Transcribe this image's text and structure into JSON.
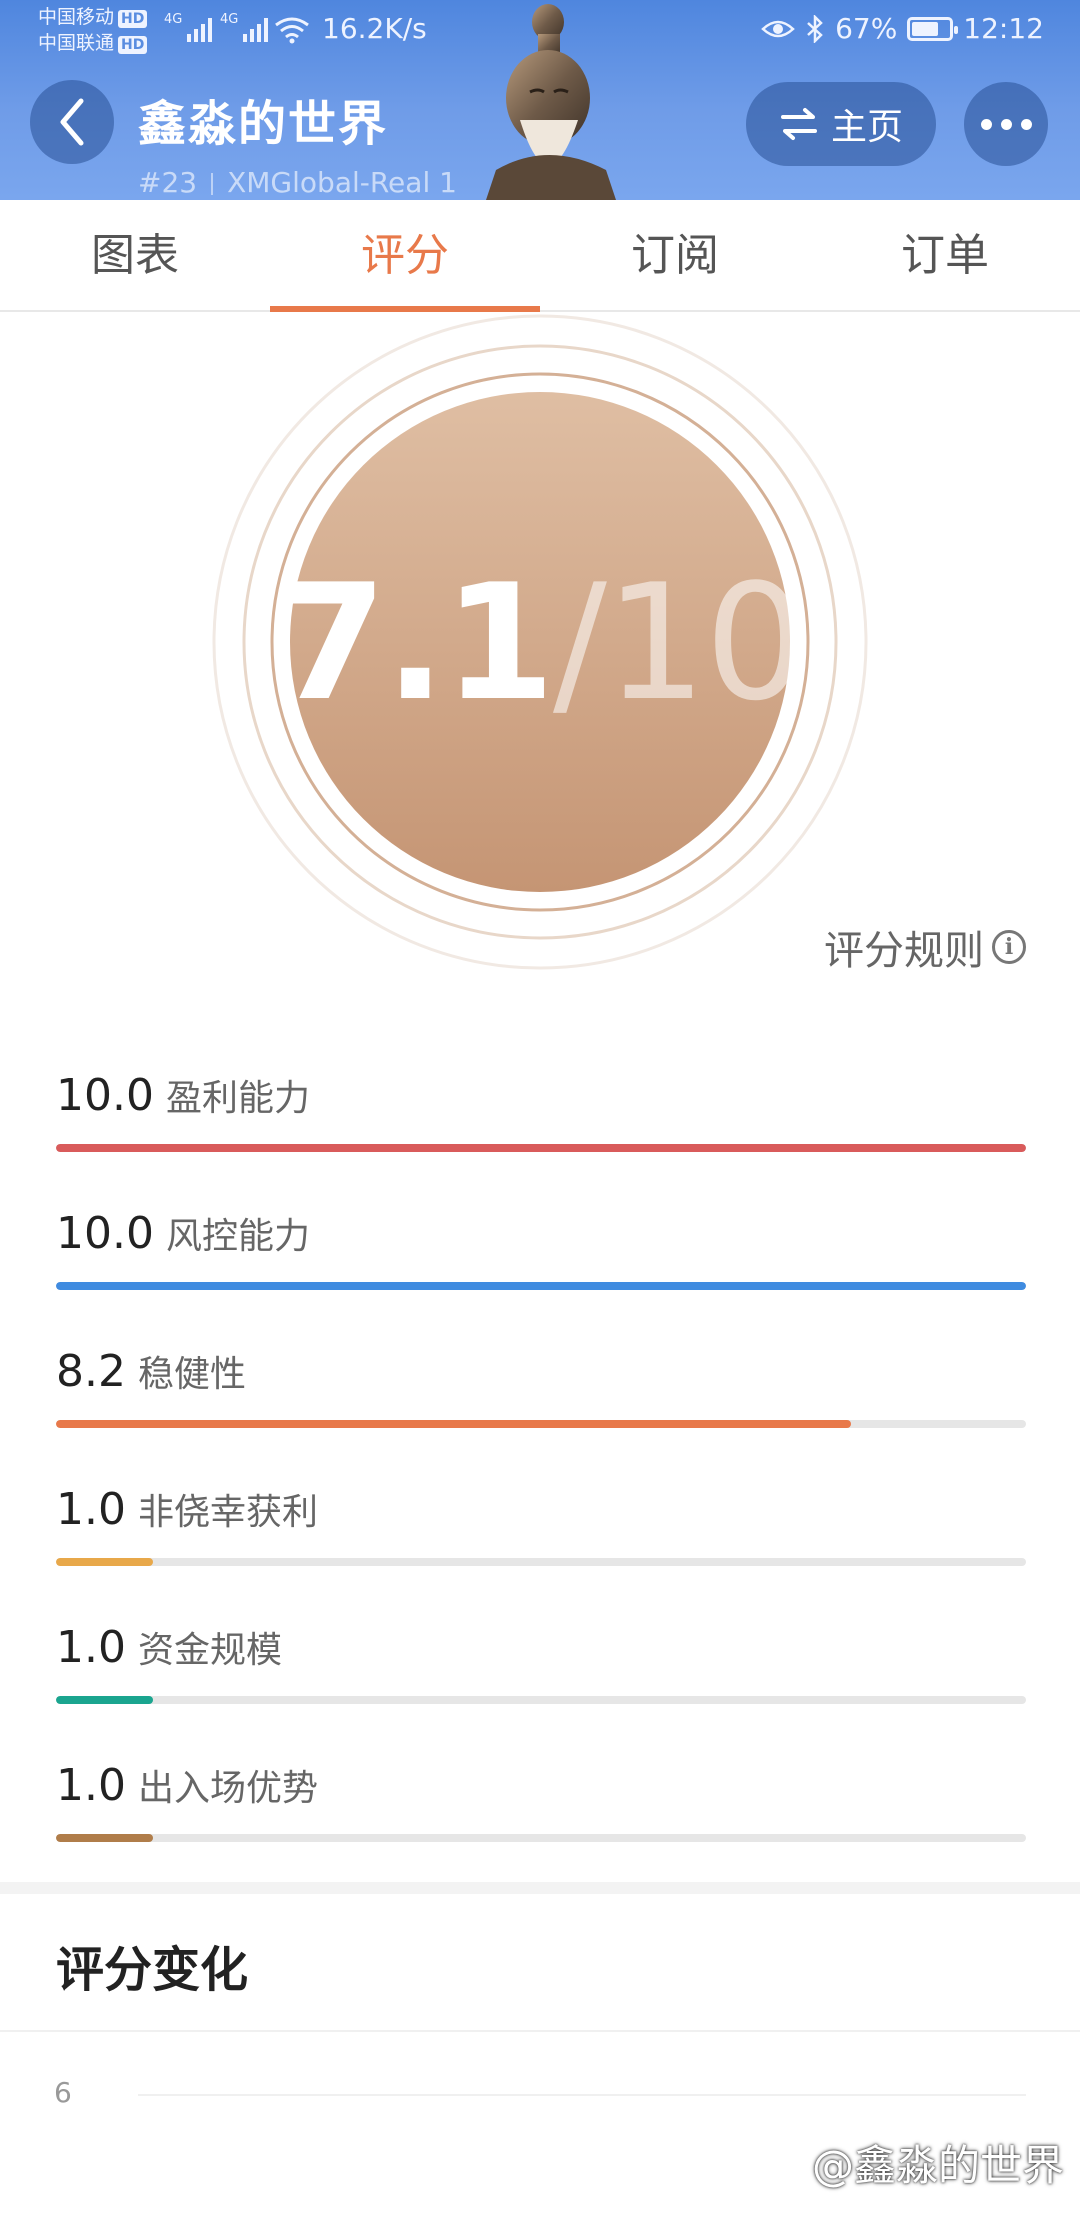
{
  "status_bar": {
    "carrier_1": "中国移动",
    "carrier_2": "中国联通",
    "hd_badge": "HD",
    "network_type": "4G",
    "net_speed": "16.2K/s",
    "battery": "67%",
    "time": "12:12"
  },
  "header": {
    "title": "鑫淼的世界",
    "rank": "#23",
    "account": "XMGlobal-Real 1",
    "home_label": "主页"
  },
  "tabs": [
    {
      "label": "图表",
      "active": false
    },
    {
      "label": "评分",
      "active": true
    },
    {
      "label": "订阅",
      "active": false
    },
    {
      "label": "订单",
      "active": false
    }
  ],
  "score": {
    "value": "7.1",
    "denominator": "/10"
  },
  "rules_label": "评分规则",
  "metrics": [
    {
      "value": "10.0",
      "name": "盈利能力",
      "fraction": 1.0,
      "color": "#d95b5b"
    },
    {
      "value": "10.0",
      "name": "风控能力",
      "fraction": 1.0,
      "color": "#3f8be0"
    },
    {
      "value": "8.2",
      "name": "稳健性",
      "fraction": 0.82,
      "color": "#e8794a"
    },
    {
      "value": "1.0",
      "name": "非侥幸获利",
      "fraction": 0.1,
      "color": "#e8a84a"
    },
    {
      "value": "1.0",
      "name": "资金规模",
      "fraction": 0.1,
      "color": "#1aa58f"
    },
    {
      "value": "1.0",
      "name": "出入场优势",
      "fraction": 0.1,
      "color": "#b07d4a"
    }
  ],
  "score_history": {
    "title": "评分变化",
    "y_tick": "6"
  },
  "watermark": "@鑫淼的世界"
}
